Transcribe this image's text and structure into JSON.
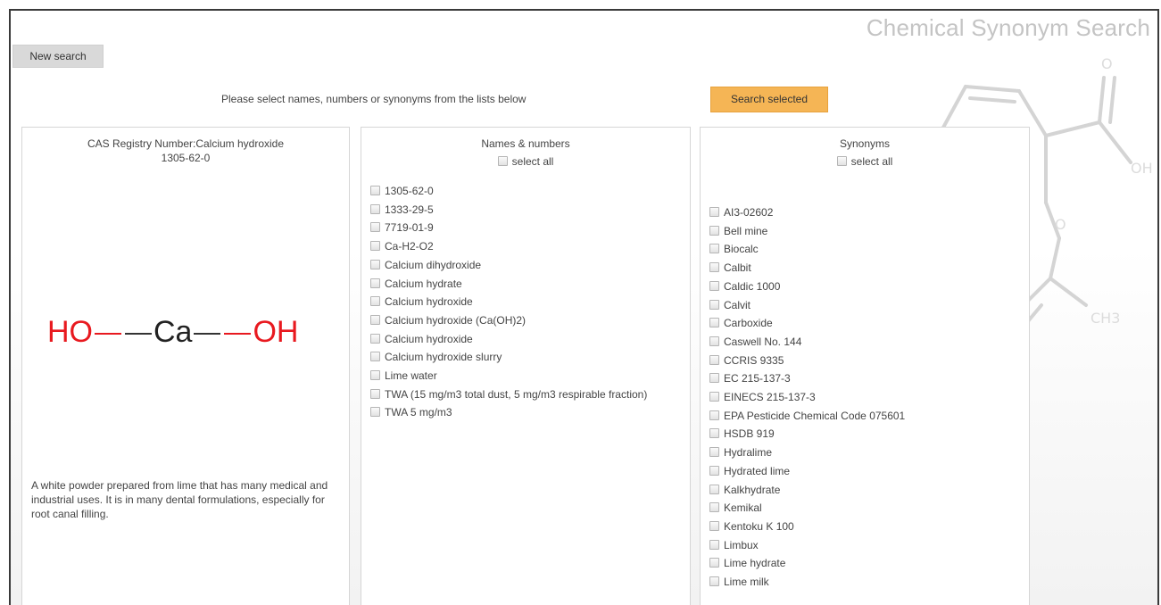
{
  "app_title": "Chemical Synonym Search",
  "toolbar": {
    "new_search_label": "New search",
    "instructions": "Please select names, numbers or synonyms from the lists below",
    "search_selected_label": "Search selected"
  },
  "cas_panel": {
    "title": "CAS Registry Number:Calcium hydroxide",
    "cas_number": "1305-62-0",
    "structure": {
      "left_group": "HO",
      "center_atom": "Ca",
      "right_group": "OH"
    },
    "description": "A white powder prepared from lime that has many medical and industrial uses. It is in many dental formulations, especially for root canal filling."
  },
  "names_panel": {
    "header": "Names & numbers",
    "select_all_label": "select all",
    "items": [
      "1305-62-0",
      "1333-29-5",
      "7719-01-9",
      "Ca-H2-O2",
      "Calcium dihydroxide",
      "Calcium hydrate",
      "Calcium hydroxide",
      "Calcium hydroxide (Ca(OH)2)",
      "Calcium hydroxide",
      "Calcium hydroxide slurry",
      "Lime water",
      "TWA (15 mg/m3 total dust, 5 mg/m3 respirable fraction)",
      "TWA 5 mg/m3"
    ]
  },
  "synonyms_panel": {
    "header": "Synonyms",
    "select_all_label": "select all",
    "items": [
      "AI3-02602",
      "Bell mine",
      "Biocalc",
      "Calbit",
      "Caldic 1000",
      "Calvit",
      "Carboxide",
      "Caswell No. 144",
      "CCRIS 9335",
      "EC 215-137-3",
      "EINECS 215-137-3",
      "EPA Pesticide Chemical Code 075601",
      "HSDB 919",
      "Hydralime",
      "Hydrated lime",
      "Kalkhydrate",
      "Kemikal",
      "Kentoku K 100",
      "Limbux",
      "Lime hydrate",
      "Lime milk"
    ]
  },
  "colors": {
    "accent_button": "#f5b555",
    "oxygen_red": "#e8191f",
    "title_gray": "#c4c4c4"
  }
}
